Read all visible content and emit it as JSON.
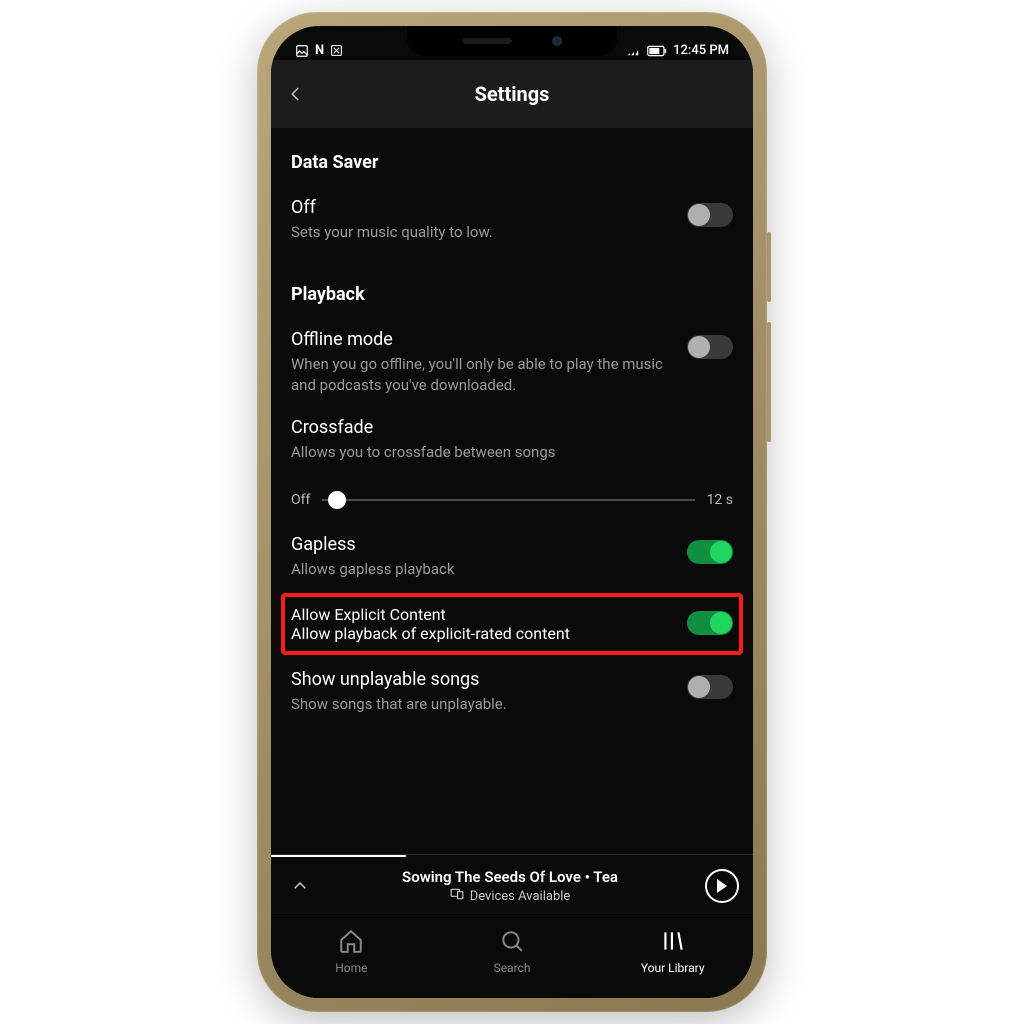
{
  "statusbar": {
    "time": "12:45 PM"
  },
  "header": {
    "title": "Settings"
  },
  "sections": {
    "dataSaver": {
      "title": "Data Saver",
      "off": {
        "title": "Off",
        "desc": "Sets your music quality to low.",
        "on": false
      }
    },
    "playback": {
      "title": "Playback",
      "offline": {
        "title": "Offline mode",
        "desc": "When you go offline, you'll only be able to play the music and podcasts you've downloaded.",
        "on": false
      },
      "crossfade": {
        "title": "Crossfade",
        "desc": "Allows you to crossfade between songs",
        "minLabel": "Off",
        "maxLabel": "12 s",
        "value": 0
      },
      "gapless": {
        "title": "Gapless",
        "desc": "Allows gapless playback",
        "on": true
      },
      "explicit": {
        "title": "Allow Explicit Content",
        "desc": "Allow playback of explicit-rated content",
        "on": true
      },
      "unplayable": {
        "title": "Show unplayable songs",
        "desc": "Show songs that are unplayable.",
        "on": false
      }
    }
  },
  "nowPlaying": {
    "track": "Sowing The Seeds Of Love • Tea",
    "devices": "Devices Available"
  },
  "tabs": {
    "home": "Home",
    "search": "Search",
    "library": "Your Library"
  }
}
